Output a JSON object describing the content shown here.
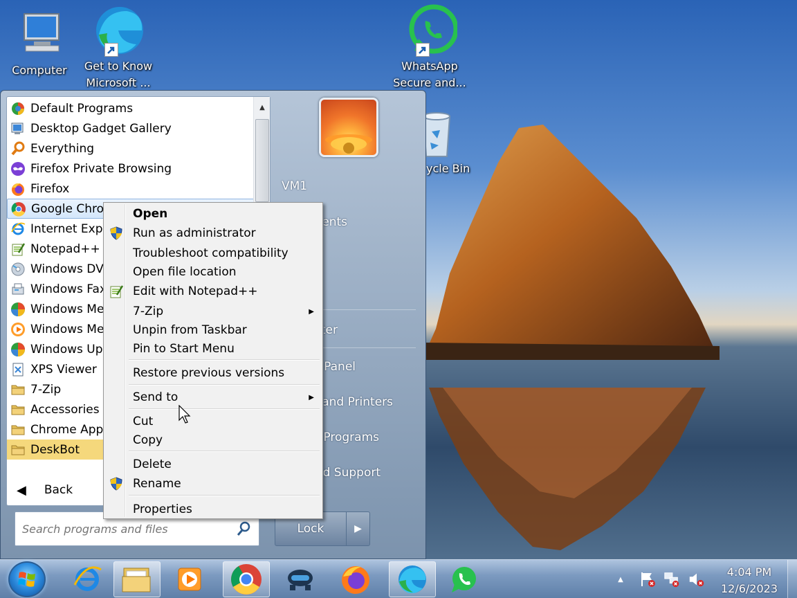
{
  "desktop": {
    "icons": [
      {
        "label": "Computer"
      },
      {
        "label": "Get to Know Microsoft ..."
      },
      {
        "label": "WhatsApp Secure and..."
      },
      {
        "label": "ycle Bin"
      }
    ]
  },
  "start_menu": {
    "programs": [
      {
        "label": "Default Programs",
        "icon": "default-programs-icon"
      },
      {
        "label": "Desktop Gadget Gallery",
        "icon": "gadget-gallery-icon"
      },
      {
        "label": "Everything",
        "icon": "everything-search-icon"
      },
      {
        "label": "Firefox Private Browsing",
        "icon": "firefox-private-icon"
      },
      {
        "label": "Firefox",
        "icon": "firefox-icon"
      },
      {
        "label": "Google Chrome",
        "icon": "chrome-icon"
      },
      {
        "label": "Internet Explorer",
        "icon": "internet-explorer-icon"
      },
      {
        "label": "Notepad++",
        "icon": "notepadpp-icon"
      },
      {
        "label": "Windows DVD Maker",
        "icon": "dvd-maker-icon"
      },
      {
        "label": "Windows Fax and Scan",
        "icon": "fax-icon"
      },
      {
        "label": "Windows Media Center",
        "icon": "media-center-icon"
      },
      {
        "label": "Windows Media Player",
        "icon": "media-player-icon"
      },
      {
        "label": "Windows Update",
        "icon": "windows-update-icon"
      },
      {
        "label": "XPS Viewer",
        "icon": "xps-viewer-icon"
      },
      {
        "label": "7-Zip",
        "icon": "folder-icon"
      },
      {
        "label": "Accessories",
        "icon": "folder-icon"
      },
      {
        "label": "Chrome Apps",
        "icon": "folder-icon"
      },
      {
        "label": "DeskBot",
        "icon": "folder-icon"
      }
    ],
    "back_label": "Back",
    "search_placeholder": "Search programs and files",
    "right_pane": {
      "user": "VM1",
      "documents": "Documents",
      "computer": "Computer",
      "control_panel": "Control Panel",
      "devices": "Devices and Printers",
      "default_programs": "Default Programs",
      "help": "Help and Support"
    },
    "lock_label": "Lock"
  },
  "context_menu": {
    "items": [
      {
        "label": "Open",
        "bold": true
      },
      {
        "label": "Run as administrator",
        "icon": "shield-icon"
      },
      {
        "label": "Troubleshoot compatibility"
      },
      {
        "label": "Open file location"
      },
      {
        "label": "Edit with Notepad++",
        "icon": "notepadpp-icon"
      },
      {
        "label": "7-Zip",
        "submenu": true
      },
      {
        "label": "Unpin from Taskbar"
      },
      {
        "label": "Pin to Start Menu"
      },
      {
        "label": "Restore previous versions"
      },
      {
        "label": "Send to",
        "submenu": true
      },
      {
        "label": "Cut"
      },
      {
        "label": "Copy"
      },
      {
        "label": "Delete"
      },
      {
        "label": "Rename",
        "icon": "shield-icon"
      },
      {
        "label": "Properties"
      }
    ]
  },
  "taskbar": {
    "time": "4:04 PM",
    "date": "12/6/2023",
    "apps": [
      "internet-explorer",
      "file-explorer",
      "media-player",
      "chrome",
      "deskbot",
      "firefox",
      "edge",
      "whatsapp"
    ]
  },
  "colors": {
    "selection_highlight": "#f5d87c",
    "hover_border": "#8fb4e0"
  }
}
